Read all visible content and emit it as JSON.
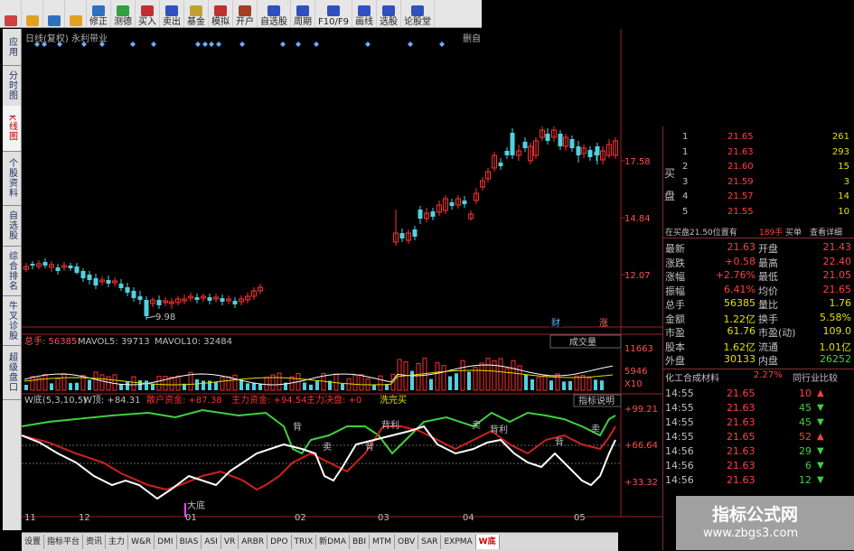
{
  "toolbar": {
    "buttons": [
      {
        "label": "",
        "icon": "grid-icon"
      },
      {
        "label": "",
        "icon": "back-arrow-icon"
      },
      {
        "label": "",
        "icon": "forward-arrow-icon"
      },
      {
        "label": "",
        "icon": "down-arrow-icon"
      },
      {
        "label": "修正",
        "icon": "edit-icon"
      },
      {
        "label": "测德",
        "icon": "test-icon"
      },
      {
        "label": "买入",
        "icon": "buy-icon"
      },
      {
        "label": "卖出",
        "icon": "sell-icon"
      },
      {
        "label": "基金",
        "icon": "fund-icon"
      },
      {
        "label": "模拟",
        "icon": "simulate-icon"
      },
      {
        "label": "开户",
        "icon": "account-icon"
      },
      {
        "label": "自选股",
        "icon": "watchlist-icon"
      },
      {
        "label": "周期",
        "icon": "clock-icon"
      },
      {
        "label": "F10/F9",
        "icon": "info-icon"
      },
      {
        "label": "画线",
        "icon": "draw-icon"
      },
      {
        "label": "选股",
        "icon": "select-icon"
      },
      {
        "label": "论股堂",
        "icon": "forum-icon"
      }
    ]
  },
  "left_tabs": [
    "应用",
    "分时图",
    "K线图",
    "个股资料",
    "自选股",
    "综合排名",
    "牛叉诊股",
    "超级盘口"
  ],
  "chart": {
    "header": "日线(复权) 永利带业",
    "header_right": "删自",
    "price_axis": [
      "17.58",
      "14.84",
      "12.07"
    ],
    "low_label": "9.98",
    "badges": [
      "财",
      "涨"
    ],
    "volume_bar": {
      "total": "总手: 56385",
      "mavol5": "MAVOL5: 39713",
      "mavol10": "MAVOL10: 32484",
      "dropdown": "成交量",
      "axis": [
        "11663",
        "5946",
        "X10"
      ]
    },
    "indicator_bar": {
      "name": "W底(5,3,10,5)",
      "w_top": "W顶: +84.31",
      "retail": "散户资金: +87.38",
      "main_funds": "主力资金: +94.54",
      "main_decision": "主力决盘: +0",
      "wash": "洗完买",
      "explain": "指标说明",
      "axis": [
        "+99.21",
        "+66.64",
        "+33.32"
      ],
      "annotations": [
        "大底",
        "背",
        "卖",
        "背",
        "背利",
        "卖",
        "背利",
        "背",
        "卖"
      ]
    },
    "x_axis": [
      "11",
      "12",
      "01",
      "02",
      "03",
      "04",
      "05"
    ]
  },
  "order_book": {
    "buy_label": [
      "买",
      "盘"
    ],
    "levels": [
      {
        "n": "1",
        "price": "21.65",
        "vol": "261"
      },
      {
        "n": "1",
        "price": "21.63",
        "vol": "293"
      },
      {
        "n": "2",
        "price": "21.60",
        "vol": "15"
      },
      {
        "n": "3",
        "price": "21.59",
        "vol": "3"
      },
      {
        "n": "4",
        "price": "21.57",
        "vol": "14"
      },
      {
        "n": "5",
        "price": "21.55",
        "vol": "10"
      }
    ],
    "note": "在买盘21.50位置有",
    "note_vol": "189手",
    "note_buy": "买单",
    "note_detail": "查看详细"
  },
  "quote": {
    "rows": [
      {
        "l1": "最新",
        "v1": "21.63",
        "l2": "开盘",
        "v2": "21.43"
      },
      {
        "l1": "涨跌",
        "v1": "+0.58",
        "l2": "最高",
        "v2": "22.40"
      },
      {
        "l1": "涨幅",
        "v1": "+2.76%",
        "l2": "最低",
        "v2": "21.05"
      },
      {
        "l1": "振幅",
        "v1": "6.41%",
        "l2": "均价",
        "v2": "21.65"
      },
      {
        "l1": "总手",
        "v1": "56385",
        "l2": "量比",
        "v2": "1.76"
      },
      {
        "l1": "金额",
        "v1": "1.22亿",
        "l2": "换手",
        "v2": "5.58%"
      },
      {
        "l1": "市盈",
        "v1": "61.76",
        "l2": "市盈(动)",
        "v2": "109.0"
      },
      {
        "l1": "股本",
        "v1": "1.62亿",
        "l2": "流通",
        "v2": "1.01亿"
      },
      {
        "l1": "外盘",
        "v1": "30133",
        "l2": "内盘",
        "v2": "26252"
      }
    ],
    "sector": "化工合成材料",
    "sector_pct": "2.27%",
    "sector_link": "同行业比较"
  },
  "ticks": [
    {
      "t": "14:55",
      "p": "21.65",
      "v": "10",
      "dir": "up"
    },
    {
      "t": "14:55",
      "p": "21.63",
      "v": "45",
      "dir": "down"
    },
    {
      "t": "14:55",
      "p": "21.63",
      "v": "45",
      "dir": "down"
    },
    {
      "t": "14:55",
      "p": "21.65",
      "v": "52",
      "dir": "up"
    },
    {
      "t": "14:56",
      "p": "21.63",
      "v": "29",
      "dir": "down"
    },
    {
      "t": "14:56",
      "p": "21.63",
      "v": "6",
      "dir": "down"
    },
    {
      "t": "14:56",
      "p": "21.63",
      "v": "12",
      "dir": "down"
    }
  ],
  "bottom_tabs": [
    "设置",
    "指标平台",
    "资讯",
    "主力",
    "W&R",
    "DMI",
    "BIAS",
    "ASI",
    "VR",
    "ARBR",
    "DPO",
    "TRIX",
    "新DMA",
    "BBI",
    "MTM",
    "OBV",
    "SAR",
    "EXPMA",
    "W底"
  ],
  "watermark": {
    "title": "指标公式网",
    "url": "www.zbgs3.com"
  },
  "colors": {
    "up": "#ff3030",
    "down": "#4fd2e0",
    "accent": "#ff4040"
  }
}
